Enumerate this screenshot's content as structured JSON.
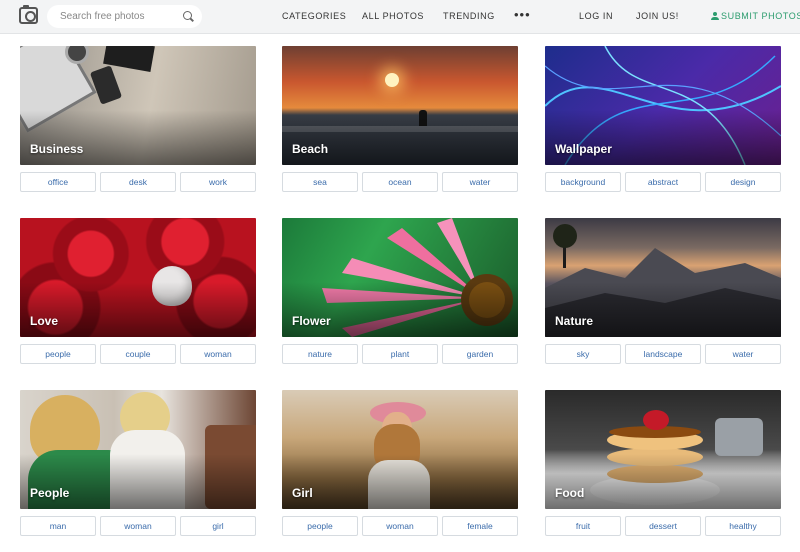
{
  "header": {
    "search_placeholder": "Search free photos",
    "nav": {
      "categories": "CATEGORIES",
      "all_photos": "ALL PHOTOS",
      "trending": "TRENDING",
      "more": "•••",
      "login": "LOG IN",
      "join": "JOIN US!",
      "submit": "SUBMIT PHOTOS"
    },
    "colors": {
      "accent": "#2c9c6e",
      "tag_text": "#3b6cab"
    }
  },
  "categories": [
    {
      "title": "Business",
      "tags": [
        "office",
        "desk",
        "work"
      ]
    },
    {
      "title": "Beach",
      "tags": [
        "sea",
        "ocean",
        "water"
      ]
    },
    {
      "title": "Wallpaper",
      "tags": [
        "background",
        "abstract",
        "design"
      ]
    },
    {
      "title": "Love",
      "tags": [
        "people",
        "couple",
        "woman"
      ]
    },
    {
      "title": "Flower",
      "tags": [
        "nature",
        "plant",
        "garden"
      ]
    },
    {
      "title": "Nature",
      "tags": [
        "sky",
        "landscape",
        "water"
      ]
    },
    {
      "title": "People",
      "tags": [
        "man",
        "woman",
        "girl"
      ]
    },
    {
      "title": "Girl",
      "tags": [
        "people",
        "woman",
        "female"
      ]
    },
    {
      "title": "Food",
      "tags": [
        "fruit",
        "dessert",
        "healthy"
      ]
    }
  ]
}
